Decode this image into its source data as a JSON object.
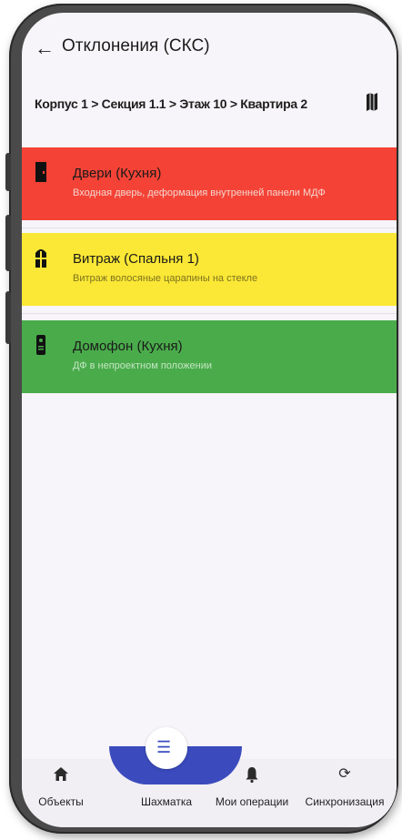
{
  "app": {
    "title": "Отклонения (СКС)",
    "breadcrumb": "Корпус 1 > Секция 1.1 > Этаж 10 > Квартира 2"
  },
  "items": [
    {
      "title": "Двери (Кухня)",
      "subtitle": "Входная дверь, деформация внутренней панели МДФ",
      "color": "#f44336",
      "icon": "door-icon"
    },
    {
      "title": "Витраж (Спальня 1)",
      "subtitle": "Витраж волосяные царапины на стекле",
      "color": "#fbe735",
      "icon": "window-icon"
    },
    {
      "title": "Домофон (Кухня)",
      "subtitle": "ДФ в непроектном положении",
      "color": "#4aab4b",
      "icon": "intercom-icon"
    }
  ],
  "nav": [
    {
      "label": "Объекты",
      "icon": "home-icon"
    },
    {
      "label": "Шахматка",
      "icon": "checklist-icon"
    },
    {
      "label": "Мои операции",
      "icon": "bell-icon"
    },
    {
      "label": "Синхронизация",
      "icon": "sync-icon"
    }
  ],
  "colors": {
    "accent": "#3b4bbd"
  }
}
